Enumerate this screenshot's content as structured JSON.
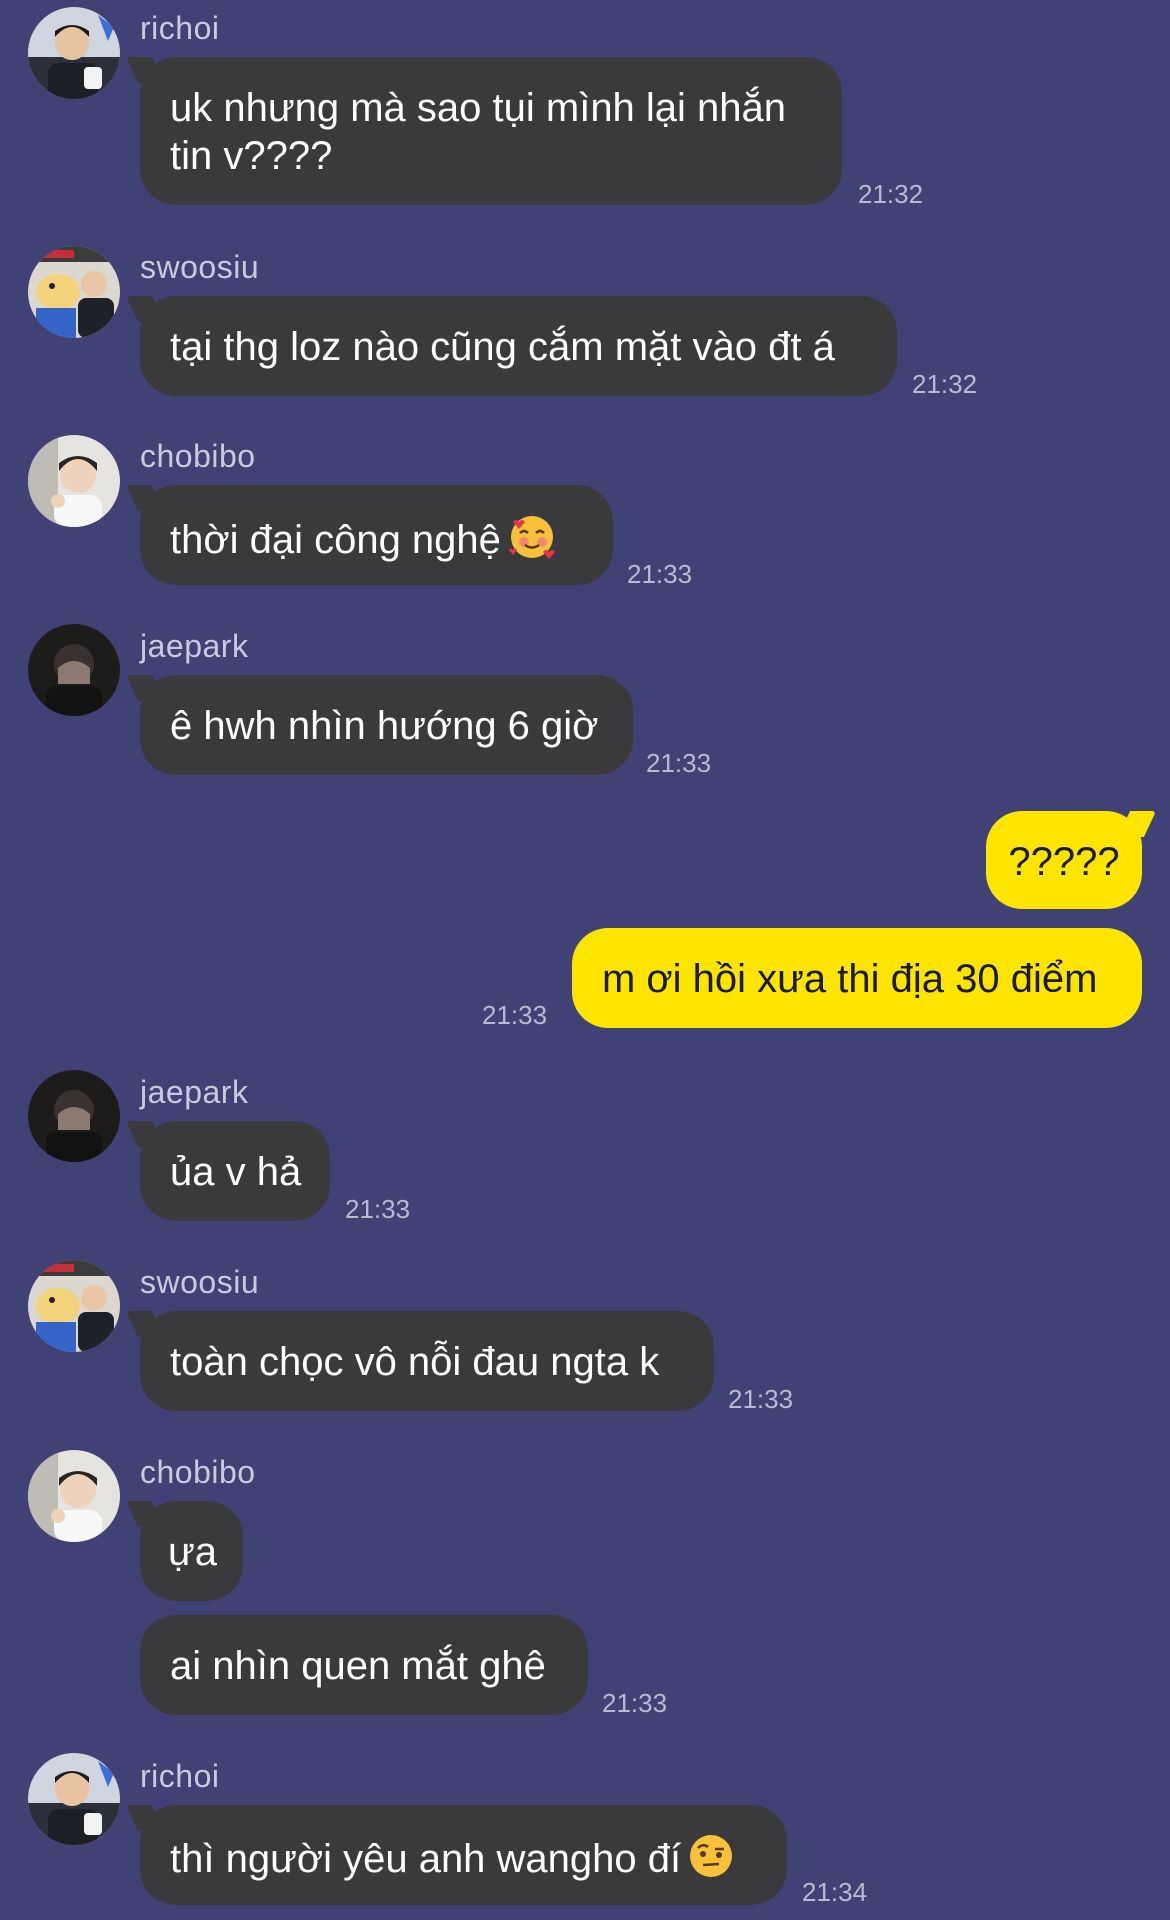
{
  "messages": [
    {
      "sender": "richoi",
      "text": "uk nhưng mà sao tụi mình lại nhắn tin v????",
      "time": "21:32"
    },
    {
      "sender": "swoosiu",
      "text": "tại thg loz nào cũng cắm mặt vào đt á",
      "time": "21:32"
    },
    {
      "sender": "chobibo",
      "text": "thời đại công nghệ",
      "emoji": "smiling-face-with-hearts",
      "time": "21:33"
    },
    {
      "sender": "jaepark",
      "text": "ê hwh nhìn hướng 6 giờ",
      "time": "21:33"
    },
    {
      "sender": "me",
      "text": "?????"
    },
    {
      "sender": "me",
      "text": "m ơi hồi xưa thi địa 30 điểm",
      "time": "21:33"
    },
    {
      "sender": "jaepark",
      "text": "ủa v hả",
      "time": "21:33"
    },
    {
      "sender": "swoosiu",
      "text": "toàn chọc vô nỗi đau ngta k",
      "time": "21:33"
    },
    {
      "sender": "chobibo",
      "text": "ựa"
    },
    {
      "sender": "chobibo",
      "text": "ai nhìn quen mắt ghê",
      "time": "21:33"
    },
    {
      "sender": "richoi",
      "text": "thì người yêu anh wangho đí",
      "emoji": "face-with-raised-eyebrow",
      "time": "21:34"
    }
  ],
  "colors": {
    "background": "#404175",
    "incoming_bubble": "#3a3a3c",
    "outgoing_bubble": "#fee500"
  }
}
